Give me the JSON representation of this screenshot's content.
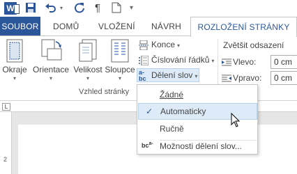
{
  "qat": {
    "app_letter": "W",
    "undo_icon": "undo-icon",
    "redo_icon": "repeat-icon",
    "pilcrow": "¶"
  },
  "tabs": {
    "file": "SOUBOR",
    "home": "DOMŮ",
    "insert": "VLOŽENÍ",
    "design": "NÁVRH",
    "layout": "ROZLOŽENÍ STRÁNKY"
  },
  "ribbon": {
    "margins": "Okraje",
    "orientation": "Orientace",
    "size": "Velikost",
    "columns": "Sloupce",
    "breaks": "Konce",
    "line_numbers": "Číslování řádků",
    "hyphenation": "Dělení slov",
    "group_page_setup": "Vzhled stránky",
    "indent_title": "Zvětšit odsazení",
    "indent_left_label": "Vlevo:",
    "indent_right_label": "Vpravo:",
    "indent_left_value": "0 cm",
    "indent_right_value": "0 cm"
  },
  "menu": {
    "none": "Žádné",
    "automatic": "Automaticky",
    "manual": "Ručně",
    "options": "Možnosti dělení slov..."
  },
  "ruler": {
    "vertical_mark": "2"
  },
  "colors": {
    "accent": "#2b579a",
    "hover": "#dcebf7"
  }
}
